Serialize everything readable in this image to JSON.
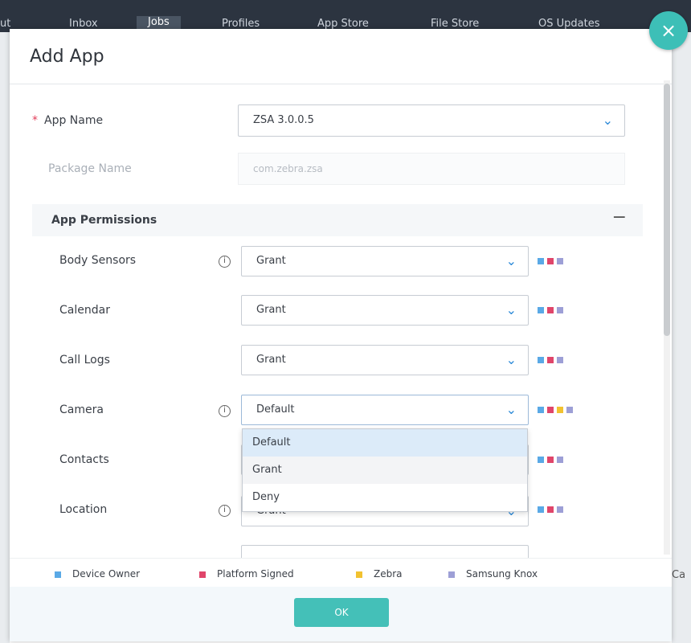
{
  "nav": {
    "tabs": [
      {
        "label": "ut"
      },
      {
        "label": "Inbox"
      },
      {
        "label": "Jobs"
      },
      {
        "label": "Profiles"
      },
      {
        "label": "App Store"
      },
      {
        "label": "File Store"
      },
      {
        "label": "OS Updates"
      }
    ],
    "right_cutoff": "Ca"
  },
  "modal": {
    "title": "Add App",
    "close_icon": "×"
  },
  "form": {
    "app_name_label": "App Name",
    "app_name_value": "ZSA 3.0.0.5",
    "package_name_label": "Package Name",
    "package_name_value": "com.zebra.zsa"
  },
  "permissions": {
    "title": "App Permissions",
    "collapse_symbol": "−",
    "rows": [
      {
        "label": "Body Sensors",
        "value": "Grant",
        "info": true,
        "dots": [
          "blue",
          "red",
          "purple"
        ]
      },
      {
        "label": "Calendar",
        "value": "Grant",
        "info": false,
        "dots": [
          "blue",
          "red",
          "purple"
        ]
      },
      {
        "label": "Call Logs",
        "value": "Grant",
        "info": false,
        "dots": [
          "blue",
          "red",
          "purple"
        ]
      },
      {
        "label": "Camera",
        "value": "Default",
        "info": true,
        "dots": [
          "blue",
          "red",
          "yellow",
          "purple"
        ]
      },
      {
        "label": "Contacts",
        "value": "",
        "info": false,
        "dots": [
          "blue",
          "red",
          "purple"
        ]
      },
      {
        "label": "Location",
        "value": "Grant",
        "info": true,
        "dots": [
          "blue",
          "red",
          "purple"
        ]
      }
    ],
    "dropdown_options": [
      "Default",
      "Grant",
      "Deny"
    ]
  },
  "legend": [
    {
      "label": "Device Owner",
      "color": "#5aa9e6"
    },
    {
      "label": "Platform Signed",
      "color": "#e0456a"
    },
    {
      "label": "Zebra",
      "color": "#f2c230"
    },
    {
      "label": "Samsung Knox",
      "color": "#9d9fd6"
    }
  ],
  "colors": {
    "blue": "#5aa9e6",
    "red": "#e0456a",
    "yellow": "#f2c230",
    "purple": "#9d9fd6",
    "accent": "#44c0b8"
  },
  "footer": {
    "ok_label": "OK"
  }
}
